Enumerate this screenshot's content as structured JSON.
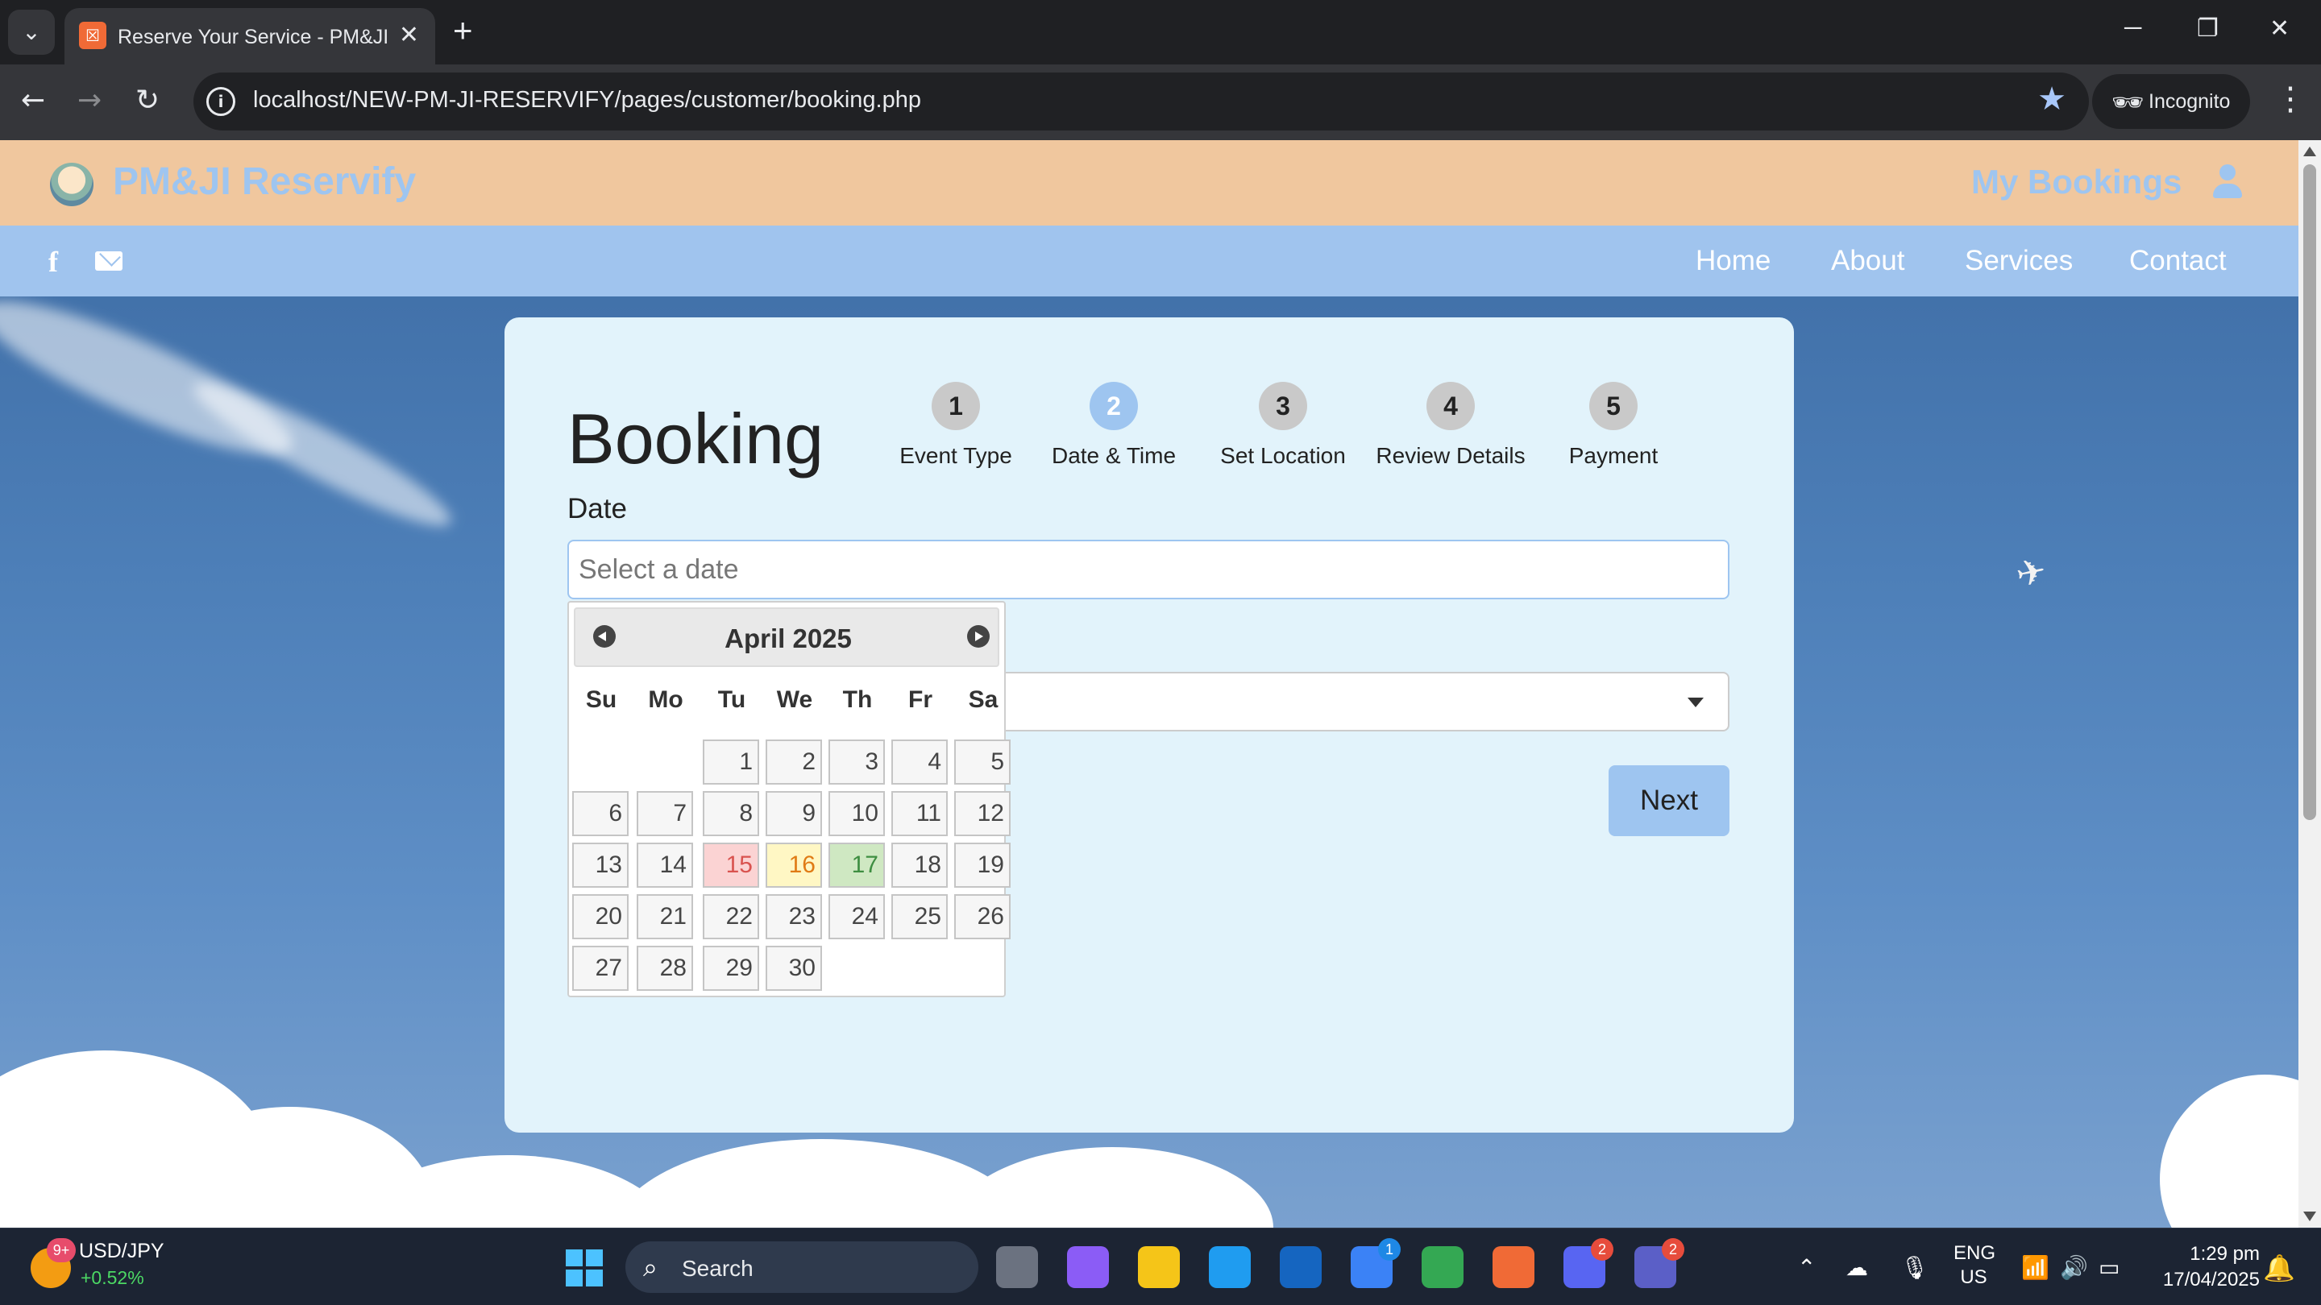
{
  "browser": {
    "tab_title": "Reserve Your Service - PM&JI Reservify",
    "favicon_glyph": "☒",
    "url": "localhost/NEW-PM-JI-RESERVIFY/pages/customer/booking.php",
    "incognito_label": "Incognito",
    "icons": [
      "tab-search-icon",
      "close-icon",
      "new-tab-icon",
      "minimize-icon",
      "restore-icon",
      "back-icon",
      "forward-icon",
      "reload-icon",
      "info-icon",
      "bookmark-star-icon",
      "incognito-icon",
      "menu-icon"
    ]
  },
  "header": {
    "brand": "PM&JI Reservify",
    "my_bookings": "My Bookings",
    "brand_color": "#9ec5f0",
    "header_bg": "#f0c79e"
  },
  "nav": {
    "social": [
      "facebook-icon",
      "mail-icon"
    ],
    "links": [
      "Home",
      "About",
      "Services",
      "Contact"
    ],
    "nav_bg": "#a0c4ee"
  },
  "booking": {
    "title": "Booking",
    "steps": [
      {
        "number": "1",
        "label": "Event Type",
        "active": false
      },
      {
        "number": "2",
        "label": "Date & Time",
        "active": true
      },
      {
        "number": "3",
        "label": "Set Location",
        "active": false
      },
      {
        "number": "4",
        "label": "Review Details",
        "active": false
      },
      {
        "number": "5",
        "label": "Payment",
        "active": false
      }
    ],
    "date_label": "Date",
    "date_placeholder": "Select a date",
    "next_label": "Next"
  },
  "datepicker": {
    "month_year": "April 2025",
    "weekdays": [
      "Su",
      "Mo",
      "Tu",
      "We",
      "Th",
      "Fr",
      "Sa"
    ],
    "first_weekday_index": 2,
    "days_in_month": 30,
    "highlights": {
      "15": "red",
      "16": "yellow",
      "17": "green"
    },
    "highlight_colors": {
      "red": "#fbd3d3",
      "yellow": "#fff7c4",
      "green": "#cfe8c2"
    }
  },
  "taskbar": {
    "ticker_name": "USD/JPY",
    "ticker_change": "+0.52%",
    "widget_badge": "9+",
    "search_label": "Search",
    "apps": [
      {
        "name": "task-view",
        "badge": ""
      },
      {
        "name": "copilot",
        "badge": ""
      },
      {
        "name": "file-explorer",
        "badge": ""
      },
      {
        "name": "edge",
        "badge": ""
      },
      {
        "name": "outlook",
        "badge": ""
      },
      {
        "name": "microsoft-store",
        "badge": "1"
      },
      {
        "name": "chrome",
        "badge": ""
      },
      {
        "name": "xampp",
        "badge": ""
      },
      {
        "name": "discord",
        "badge": "2"
      },
      {
        "name": "teams",
        "badge": "2"
      }
    ],
    "lang_line1": "ENG",
    "lang_line2": "US",
    "time": "1:29 pm",
    "date": "17/04/2025"
  }
}
